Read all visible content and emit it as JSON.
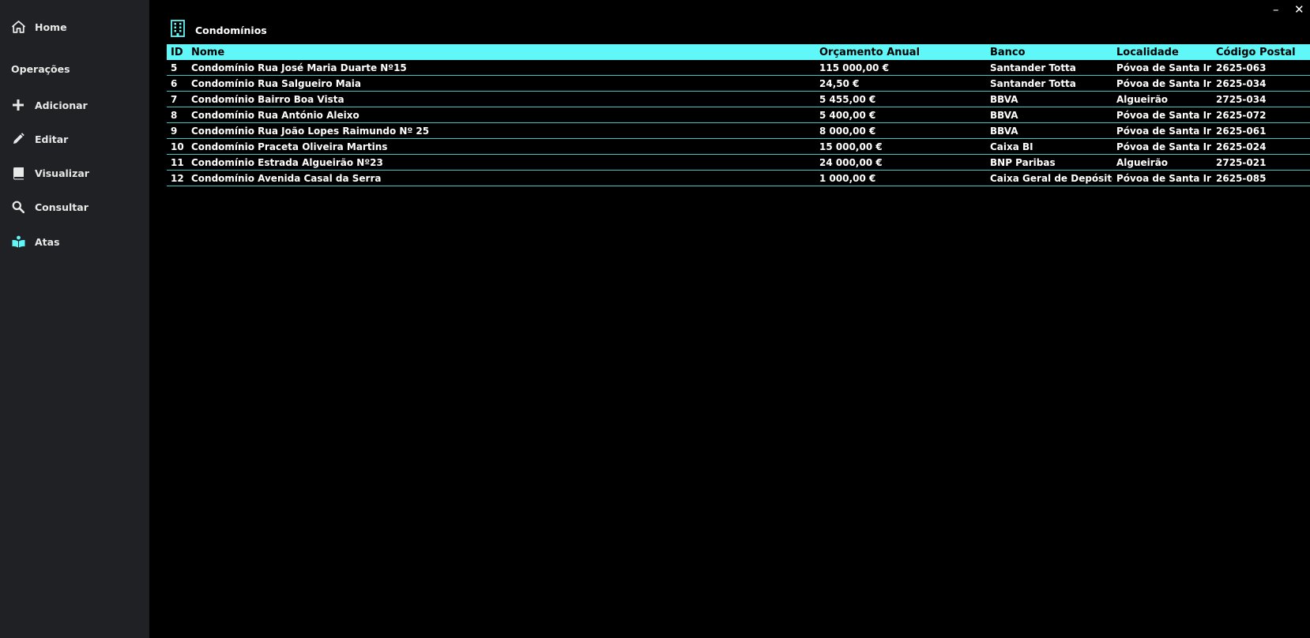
{
  "window": {
    "minimize_label": "–",
    "close_label": "✕"
  },
  "sidebar": {
    "home": {
      "label": "Home",
      "icon": "home-icon"
    },
    "section_title": "Operações",
    "items": [
      {
        "label": "Adicionar",
        "icon": "plus-icon"
      },
      {
        "label": "Editar",
        "icon": "pencil-icon"
      },
      {
        "label": "Visualizar",
        "icon": "book-icon"
      },
      {
        "label": "Consultar",
        "icon": "search-icon"
      },
      {
        "label": "Atas",
        "icon": "open-book-icon"
      }
    ]
  },
  "header": {
    "title": "Condomínios",
    "icon": "building-icon"
  },
  "colors": {
    "accent": "#5ff7f7",
    "sidebar_bg": "#202124",
    "main_bg": "#000000",
    "row_border": "#3fc6c6"
  },
  "table": {
    "columns": [
      "ID",
      "Nome",
      "Orçamento Anual",
      "Banco",
      "Localidade",
      "Código Postal"
    ],
    "rows": [
      [
        "5",
        "Condomínio Rua José Maria Duarte Nº15",
        "115 000,00 €",
        "Santander Totta",
        "Póvoa de Santa Iria",
        "2625-063"
      ],
      [
        "6",
        "Condomínio Rua Salgueiro Maia",
        "24,50 €",
        "Santander Totta",
        "Póvoa de Santa Iria",
        "2625-034"
      ],
      [
        "7",
        "Condomínio Bairro Boa Vista",
        "5 455,00 €",
        "BBVA",
        "Algueirão",
        "2725-034"
      ],
      [
        "8",
        "Condomínio Rua António Aleixo",
        "5 400,00 €",
        "BBVA",
        "Póvoa de Santa Iria",
        "2625-072"
      ],
      [
        "9",
        "Condomínio Rua João Lopes Raimundo Nº 25",
        "8 000,00 €",
        "BBVA",
        "Póvoa de Santa Iria",
        "2625-061"
      ],
      [
        "10",
        "Condomínio Praceta Oliveira Martins",
        "15 000,00 €",
        "Caixa BI",
        "Póvoa de Santa Iria",
        "2625-024"
      ],
      [
        "11",
        "Condomínio Estrada Algueirão Nº23",
        "24 000,00 €",
        "BNP Paribas",
        "Algueirão",
        "2725-021"
      ],
      [
        "12",
        "Condomínio Avenida Casal da Serra",
        "1 000,00 €",
        "Caixa Geral de Depósitos",
        "Póvoa de Santa Iria",
        "2625-085"
      ]
    ]
  }
}
